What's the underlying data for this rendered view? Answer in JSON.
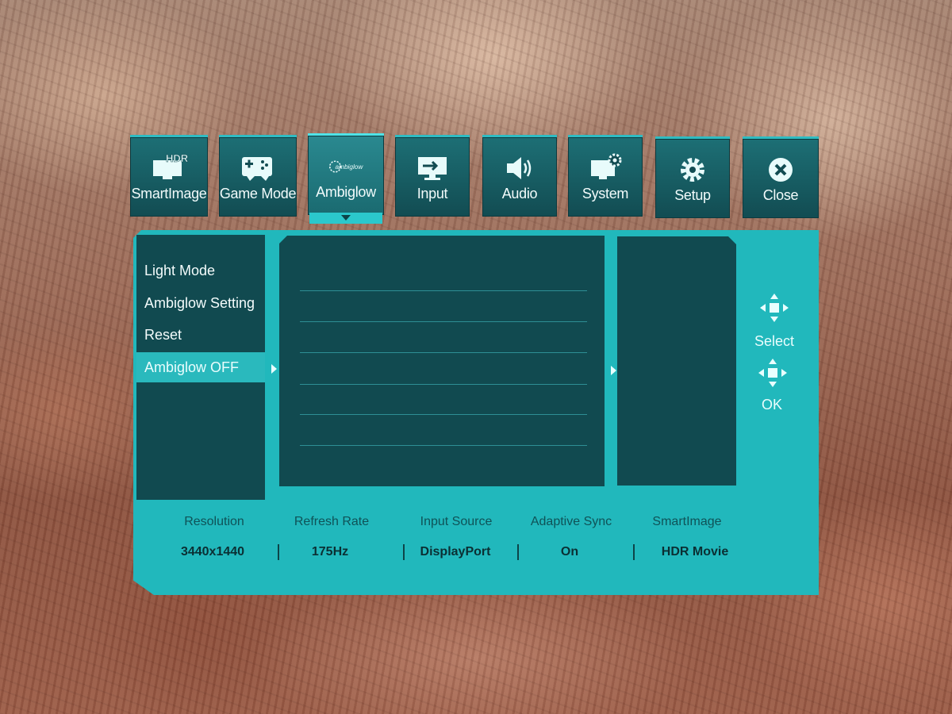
{
  "tabs": [
    {
      "label": "SmartImage",
      "badge": "HDR",
      "icon": "hdr-monitor-icon"
    },
    {
      "label": "Game Mode",
      "icon": "gamepad-icon"
    },
    {
      "label": "Ambiglow",
      "badge": "ambiglow",
      "icon": "ambiglow-icon",
      "active": true
    },
    {
      "label": "Input",
      "icon": "input-icon"
    },
    {
      "label": "Audio",
      "icon": "speaker-icon"
    },
    {
      "label": "System",
      "icon": "system-icon"
    },
    {
      "label": "Setup",
      "icon": "gear-icon"
    },
    {
      "label": "Close",
      "icon": "close-icon"
    }
  ],
  "menu": {
    "items": [
      "Light Mode",
      "Ambiglow Setting",
      "Reset",
      "Ambiglow OFF"
    ],
    "selected_index": 3
  },
  "controls": {
    "select_label": "Select",
    "ok_label": "OK"
  },
  "status": [
    {
      "label": "Resolution",
      "value": "3440x1440"
    },
    {
      "label": "Refresh Rate",
      "value": "175Hz"
    },
    {
      "label": "Input Source",
      "value": "DisplayPort"
    },
    {
      "label": "Adaptive Sync",
      "value": "On"
    },
    {
      "label": "SmartImage",
      "value": "HDR Movie"
    }
  ],
  "colors": {
    "panel_accent": "#21b8bc",
    "panel_dark": "#114a50",
    "selected_bg": "#2ab9bd"
  }
}
